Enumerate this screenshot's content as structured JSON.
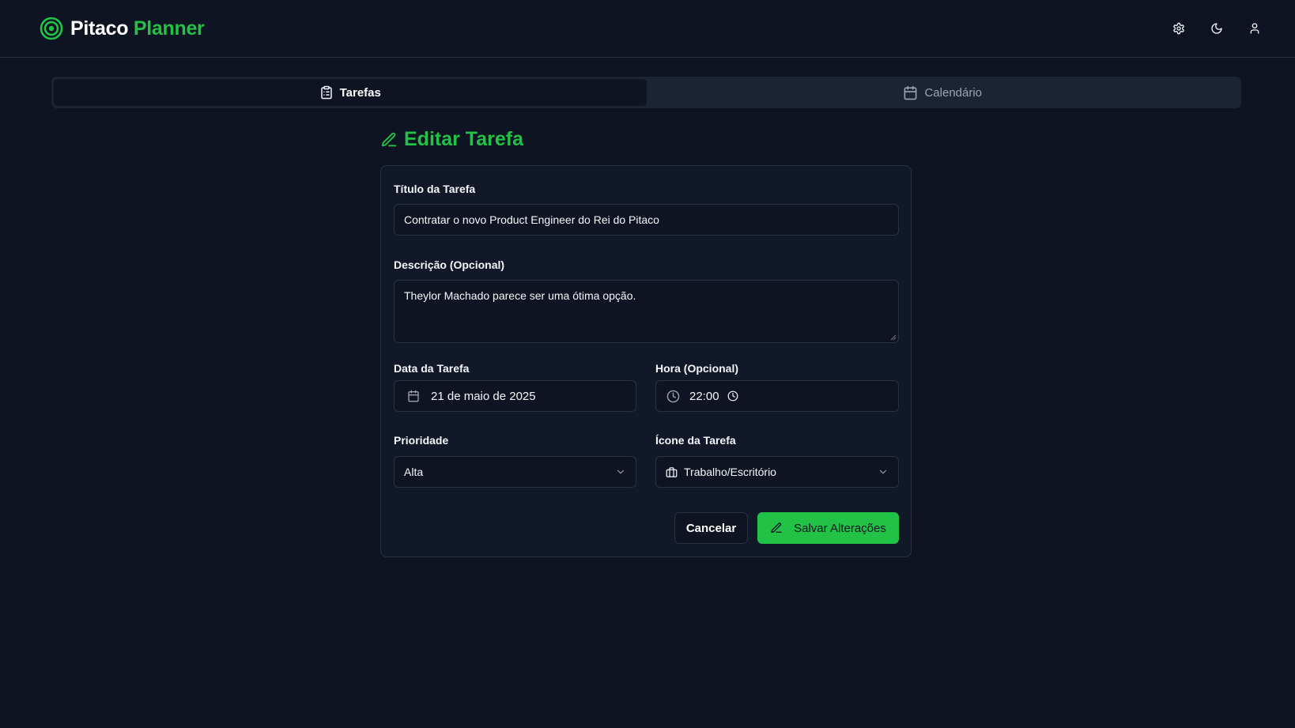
{
  "brand": {
    "name_part1": "Pitaco",
    "name_part2": "Planner"
  },
  "header": {
    "icons": [
      "gear-icon",
      "moon-icon",
      "user-icon"
    ]
  },
  "tabs": [
    {
      "label": "Tarefas",
      "icon": "clipboard-icon",
      "active": true
    },
    {
      "label": "Calendário",
      "icon": "calendar-icon",
      "active": false
    }
  ],
  "form": {
    "heading": "Editar Tarefa",
    "title_label": "Título da Tarefa",
    "title_value": "Contratar o novo Product Engineer do Rei do Pitaco",
    "description_label": "Descrição (Opcional)",
    "description_value": "Theylor Machado parece ser uma ótima opção.",
    "date_label": "Data da Tarefa",
    "date_value": "21 de maio de 2025",
    "time_label": "Hora (Opcional)",
    "time_value": "22:00",
    "priority_label": "Prioridade",
    "priority_value": "Alta",
    "icon_label": "Ícone da Tarefa",
    "icon_value": "Trabalho/Escritório",
    "cancel_label": "Cancelar",
    "save_label": "Salvar Alterações"
  },
  "colors": {
    "accent": "#22c246",
    "background": "#0e1421",
    "border": "#283142",
    "surface": "#1c2433"
  }
}
